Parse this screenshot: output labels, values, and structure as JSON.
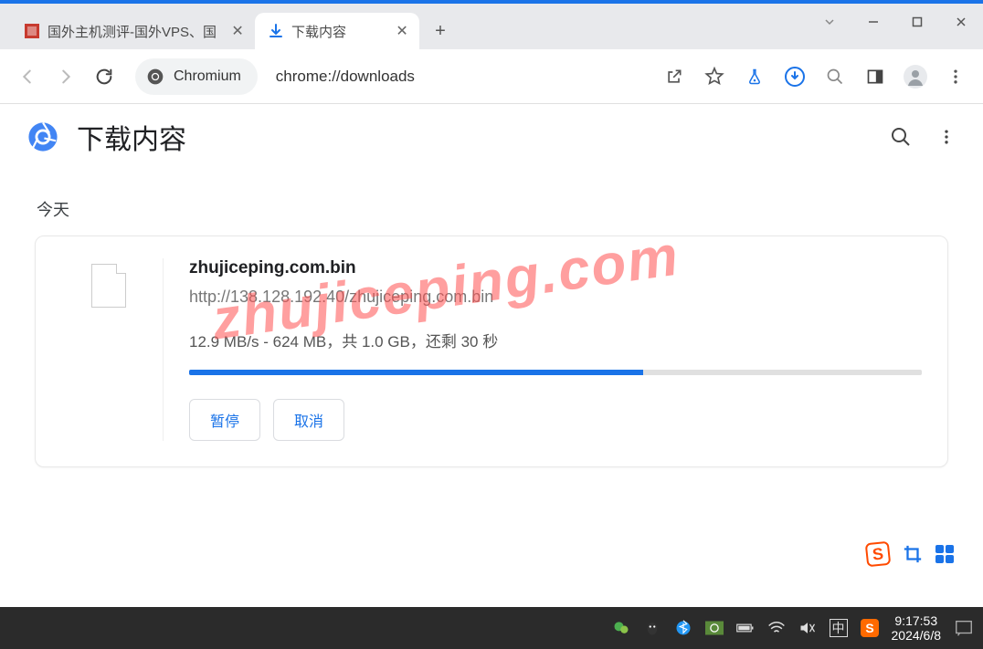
{
  "tabs": [
    {
      "title": "国外主机测评-国外VPS、国"
    },
    {
      "title": "下载内容"
    }
  ],
  "addressbar": {
    "chip": "Chromium",
    "url": "chrome://downloads"
  },
  "page": {
    "title": "下载内容",
    "section": "今天"
  },
  "download": {
    "filename": "zhujiceping.com.bin",
    "url": "http://138.128.192.40/zhujiceping.com.bin",
    "status": "12.9 MB/s - 624 MB，共 1.0 GB，还剩 30 秒",
    "progress_percent": 62,
    "pause": "暂停",
    "cancel": "取消"
  },
  "watermark": "zhujiceping.com",
  "taskbar": {
    "ime": "中",
    "time": "9:17:53",
    "date": "2024/6/8"
  }
}
